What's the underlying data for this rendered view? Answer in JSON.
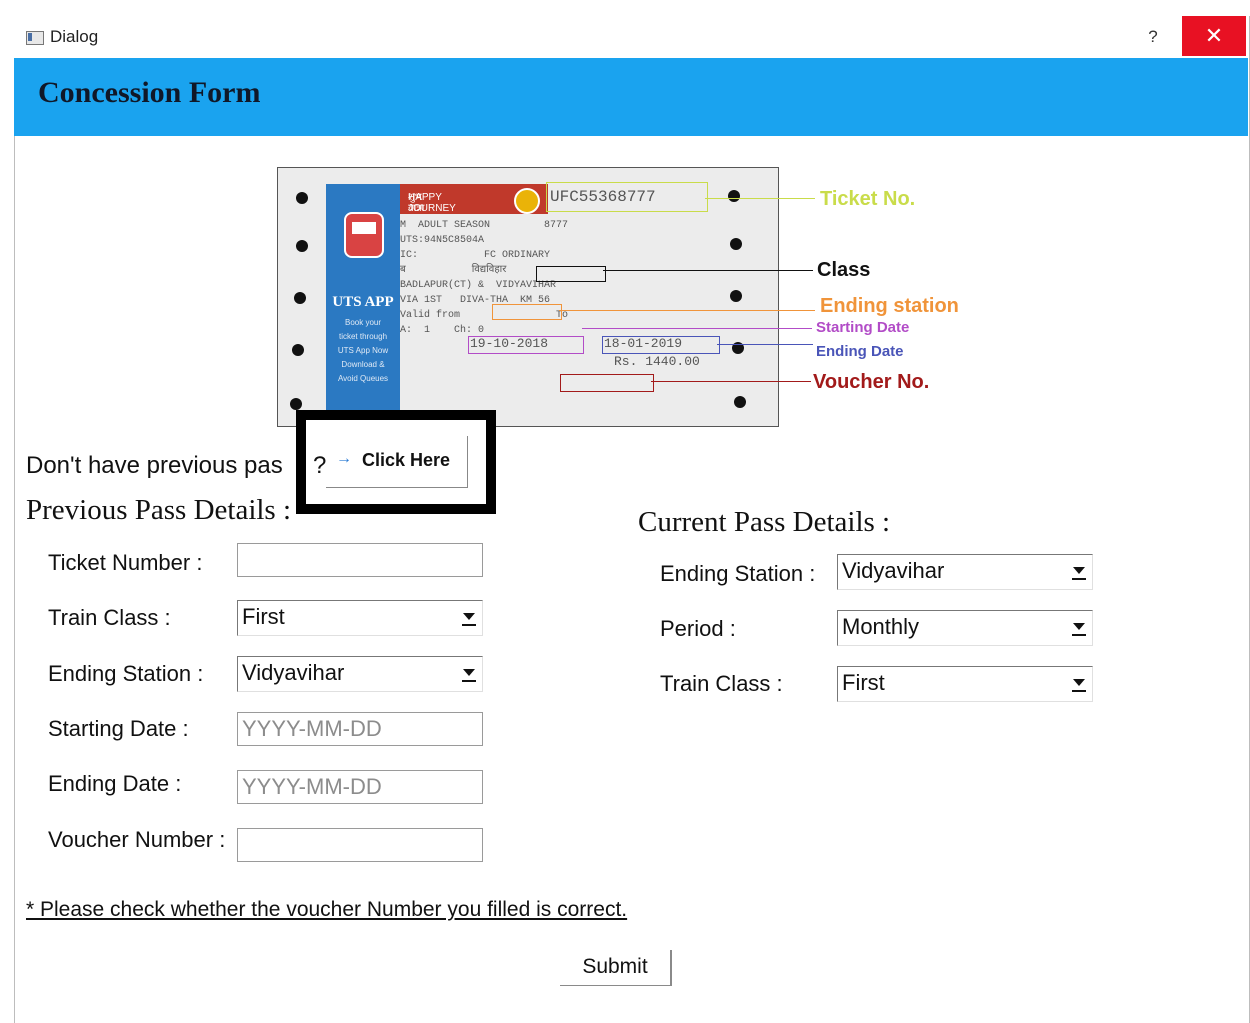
{
  "window": {
    "title": "Dialog",
    "help_label": "?",
    "close_label": "✕"
  },
  "header": {
    "title": "Concession Form",
    "background_color": "#1aa3ef"
  },
  "ticket_image": {
    "header_hindi": "शुभ यात्रा",
    "header_english": "HAPPY JOURNEY",
    "uts_app": "UTS APP",
    "ticket_number_text": "UFC55368777",
    "fare_line": "Rs. 1440.00",
    "valid_from": "19-10-2018",
    "valid_to": "18-01-2019",
    "annotations": [
      {
        "label": "Ticket No.",
        "color": "#c9dc4a"
      },
      {
        "label": "Class",
        "color": "#111111"
      },
      {
        "label": "Ending station",
        "color": "#f0943a"
      },
      {
        "label": "Starting Date",
        "color": "#b24cc7"
      },
      {
        "label": "Ending Date",
        "color": "#4a55b8"
      },
      {
        "label": "Voucher No.",
        "color": "#a21a1a"
      }
    ]
  },
  "no_previous_pass": {
    "text": "Don't have previous pas",
    "question_mark": "?",
    "button_label": "Click Here",
    "button_icon": "arrow-right-icon"
  },
  "previous_pass": {
    "title": "Previous Pass Details :",
    "ticket_number_label": "Ticket Number :",
    "ticket_number_value": "",
    "train_class_label": "Train Class :",
    "train_class_value": "First",
    "ending_station_label": "Ending Station :",
    "ending_station_value": "Vidyavihar",
    "starting_date_label": "Starting Date :",
    "starting_date_placeholder": "YYYY-MM-DD",
    "ending_date_label": "Ending Date :",
    "ending_date_placeholder": "YYYY-MM-DD",
    "voucher_number_label": "Voucher Number :",
    "voucher_number_value": ""
  },
  "current_pass": {
    "title": "Current Pass Details :",
    "ending_station_label": "Ending Station :",
    "ending_station_value": "Vidyavihar",
    "period_label": "Period :",
    "period_value": "Monthly",
    "train_class_label": "Train Class :",
    "train_class_value": "First"
  },
  "note": "* Please check whether the voucher Number  you filled is correct.",
  "submit_label": "Submit"
}
